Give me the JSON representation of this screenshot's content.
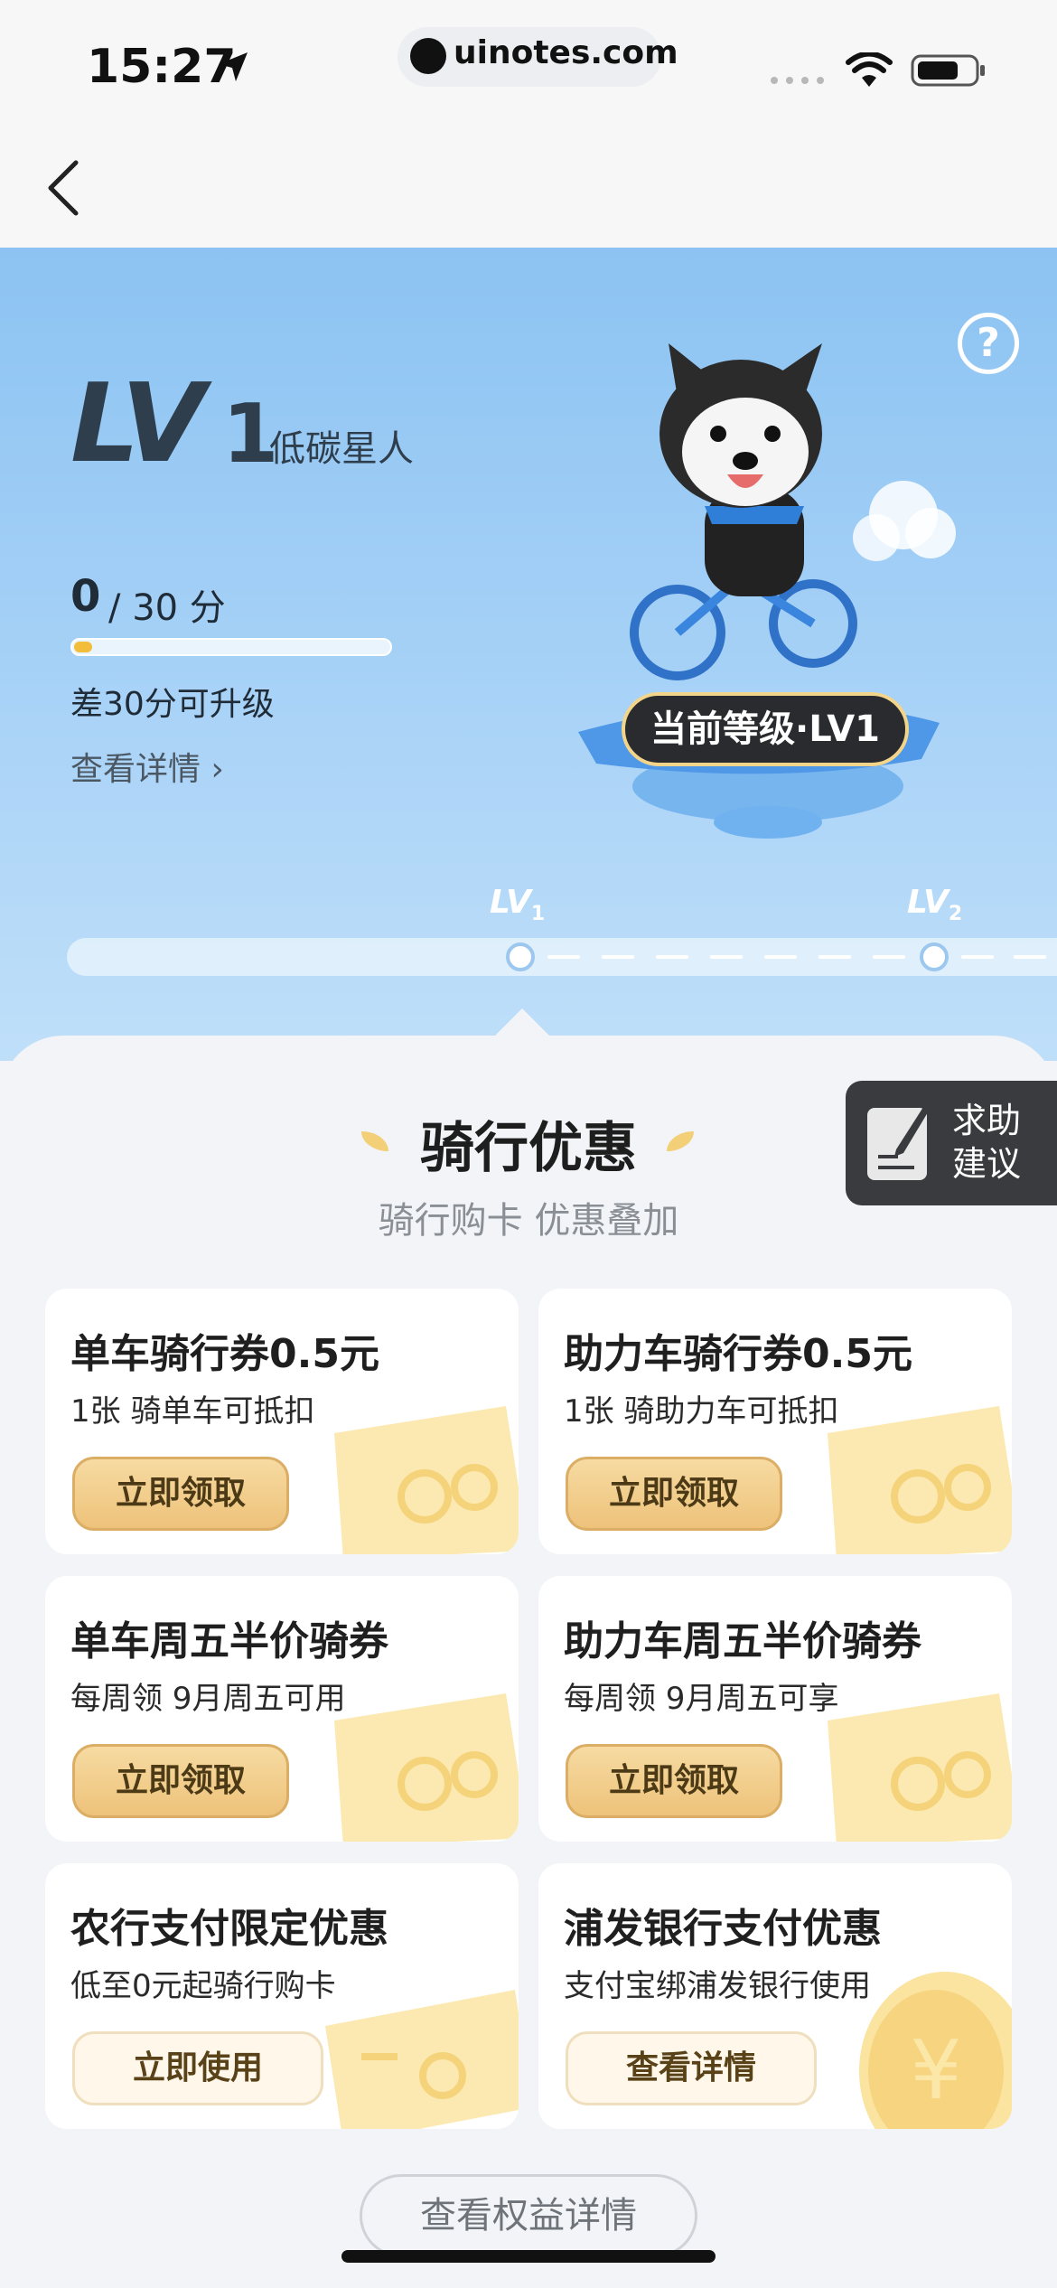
{
  "status_bar": {
    "time": "15:27",
    "url": "uinotes.com"
  },
  "level": {
    "prefix": "LV",
    "number": "1",
    "name": "低碳星人",
    "score_current": "0",
    "score_rest": "/ 30 分",
    "progress_fraction": 0.0,
    "upgrade_hint": "差30分可升级",
    "details_link": "查看详情",
    "current_badge": "当前等级·LV1",
    "help": "?"
  },
  "track": {
    "lv1": "LV",
    "lv1_sub": "1",
    "lv2": "LV",
    "lv2_sub": "2"
  },
  "section": {
    "title": "骑行优惠",
    "subtitle": "骑行购卡 优惠叠加"
  },
  "feedback": {
    "line1": "求助",
    "line2": "建议"
  },
  "cards": [
    {
      "title": "单车骑行券0.5元",
      "desc": "1张 骑单车可抵扣",
      "button": "立即领取"
    },
    {
      "title": "助力车骑行券0.5元",
      "desc": "1张 骑助力车可抵扣",
      "button": "立即领取"
    },
    {
      "title": "单车周五半价骑券",
      "desc": "每周领 9月周五可用",
      "button": "立即领取"
    },
    {
      "title": "助力车周五半价骑券",
      "desc": "每周领 9月周五可享",
      "button": "立即领取"
    },
    {
      "title": "农行支付限定优惠",
      "desc": "低至0元起骑行购卡",
      "button": "立即使用"
    },
    {
      "title": "浦发银行支付优惠",
      "desc": "支付宝绑浦发银行使用",
      "button": "查看详情"
    }
  ],
  "bottom_button": "查看权益详情",
  "colors": {
    "hero_top": "#8cc3f2",
    "accent_gold": "#eec27a",
    "badge_bg": "#2a2b2e"
  }
}
